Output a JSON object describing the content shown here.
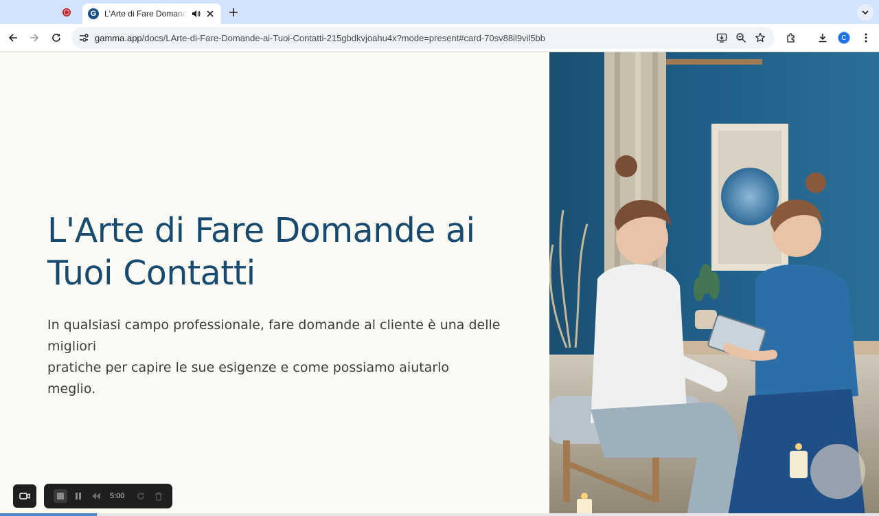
{
  "browser": {
    "tab": {
      "title": "L'Arte di Fare Domande ai Tuoi Contatti",
      "favicon": "G"
    },
    "url_host": "gamma.app",
    "url_path": "/docs/LArte-di-Fare-Domande-ai-Tuoi-Contatti-215gbdkvjoahu4x?mode=present#card-70sv88il9vil5bb",
    "profile_initial": "C"
  },
  "slide": {
    "title_line1": "L'Arte di Fare Domande ai",
    "title_line2": "Tuoi Contatti",
    "body_line1": "In qualsiasi campo professionale, fare domande al cliente è una delle migliori",
    "body_line2": "pratiche per capire le sue esigenze e come possiamo aiutarlo meglio."
  },
  "recorder": {
    "time": "5:00",
    "progress": 0.11
  },
  "colors": {
    "accent": "#174a6e",
    "tabstrip": "#d3e3fd",
    "page_bg": "#fbfaf5"
  },
  "icons": [
    "recording-indicator-icon",
    "gamma-favicon",
    "speaker-icon",
    "close-icon",
    "plus-icon",
    "chevron-down-icon",
    "back-arrow-icon",
    "forward-arrow-icon",
    "reload-icon",
    "site-info-icon",
    "install-app-icon",
    "zoom-icon",
    "bookmark-star-icon",
    "extensions-icon",
    "download-icon",
    "menu-icon",
    "camera-icon",
    "stop-icon",
    "pause-icon",
    "rewind-icon",
    "restart-icon",
    "trash-icon"
  ]
}
